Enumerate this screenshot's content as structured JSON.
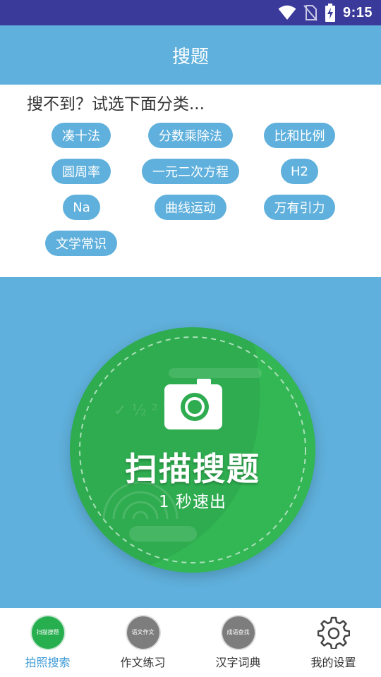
{
  "status_bar": {
    "time": "9:15",
    "icons": [
      "wifi-icon",
      "no-sim-icon",
      "battery-charging-icon"
    ]
  },
  "app_bar": {
    "title": "搜题"
  },
  "categories": {
    "hint": "搜不到？试选下面分类...",
    "chips": [
      "凑十法",
      "分数乘除法",
      "比和比例",
      "圆周率",
      "一元二次方程",
      "H2",
      "Na",
      "曲线运动",
      "万有引力",
      "文学常识"
    ]
  },
  "scan": {
    "title": "扫描搜题",
    "subtitle": "1 秒速出",
    "icon": "camera-icon",
    "color": "#2eac4f"
  },
  "bottom_nav": {
    "items": [
      {
        "label": "拍照搜索",
        "icon_text": "扫描搜题",
        "active": true
      },
      {
        "label": "作文练习",
        "icon_text": "语文作文",
        "active": false
      },
      {
        "label": "汉字词典",
        "icon_text": "成语查找",
        "active": false
      },
      {
        "label": "我的设置",
        "icon": "gear-icon",
        "active": false
      }
    ]
  },
  "colors": {
    "accent": "#5fb0dc",
    "status_bar": "#3a3a9a",
    "active_tab": "#3d9ad6"
  }
}
